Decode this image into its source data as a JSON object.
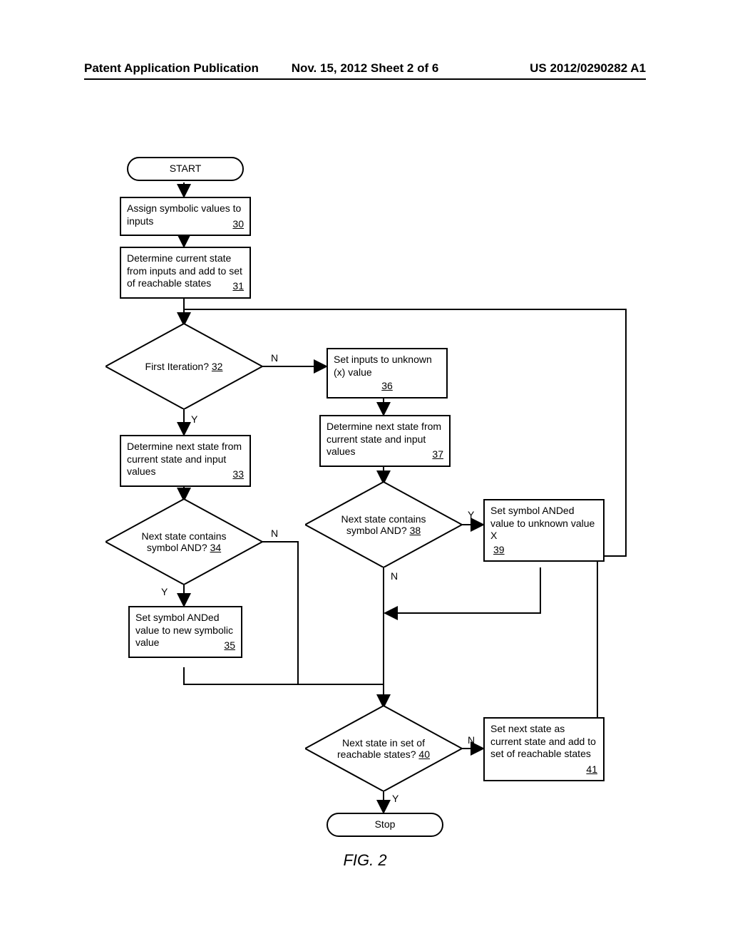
{
  "header": {
    "left": "Patent Application Publication",
    "center": "Nov. 15, 2012  Sheet 2 of 6",
    "right": "US 2012/0290282 A1"
  },
  "start": {
    "label": "START"
  },
  "stop": {
    "label": "Stop"
  },
  "box30": {
    "text": "Assign symbolic values to inputs",
    "ref": "30"
  },
  "box31": {
    "text": "Determine current state from inputs and add to set of reachable states",
    "ref": "31"
  },
  "dec32": {
    "text": "First Iteration?",
    "ref": "32"
  },
  "box33": {
    "text": "Determine next state from current state and input values",
    "ref": "33"
  },
  "dec34": {
    "text": "Next state contains symbol AND?",
    "ref": "34"
  },
  "box35": {
    "text": "Set symbol ANDed value to new symbolic value",
    "ref": "35"
  },
  "box36": {
    "text": "Set inputs to unknown (x) value",
    "ref": "36"
  },
  "box37": {
    "text": "Determine next state from current state and input values",
    "ref": "37"
  },
  "dec38": {
    "text": "Next state contains symbol AND?",
    "ref": "38"
  },
  "box39": {
    "text": "Set symbol ANDed value to unknown value X",
    "ref": "39"
  },
  "dec40": {
    "text": "Next state in set of reachable states?",
    "ref": "40"
  },
  "box41": {
    "text": "Set next state as current state and add to set of reachable states",
    "ref": "41"
  },
  "labels": {
    "Y": "Y",
    "N": "N"
  },
  "fig": "FIG. 2",
  "chart_data": {
    "type": "flowchart",
    "nodes": [
      {
        "id": "start",
        "type": "terminator",
        "label": "START"
      },
      {
        "id": "30",
        "type": "process",
        "label": "Assign symbolic values to inputs"
      },
      {
        "id": "31",
        "type": "process",
        "label": "Determine current state from inputs and add to set of reachable states"
      },
      {
        "id": "32",
        "type": "decision",
        "label": "First Iteration?"
      },
      {
        "id": "33",
        "type": "process",
        "label": "Determine next state from current state and input values"
      },
      {
        "id": "34",
        "type": "decision",
        "label": "Next state contains symbol AND?"
      },
      {
        "id": "35",
        "type": "process",
        "label": "Set symbol ANDed value to new symbolic value"
      },
      {
        "id": "36",
        "type": "process",
        "label": "Set inputs to unknown (x) value"
      },
      {
        "id": "37",
        "type": "process",
        "label": "Determine next state from current state and input values"
      },
      {
        "id": "38",
        "type": "decision",
        "label": "Next state contains symbol AND?"
      },
      {
        "id": "39",
        "type": "process",
        "label": "Set symbol ANDed value to unknown value X"
      },
      {
        "id": "40",
        "type": "decision",
        "label": "Next state in set of reachable states?"
      },
      {
        "id": "41",
        "type": "process",
        "label": "Set next state as current state and add to set of reachable states"
      },
      {
        "id": "stop",
        "type": "terminator",
        "label": "Stop"
      }
    ],
    "edges": [
      {
        "from": "start",
        "to": "30"
      },
      {
        "from": "30",
        "to": "31"
      },
      {
        "from": "31",
        "to": "32"
      },
      {
        "from": "32",
        "to": "33",
        "label": "Y"
      },
      {
        "from": "32",
        "to": "36",
        "label": "N"
      },
      {
        "from": "33",
        "to": "34"
      },
      {
        "from": "34",
        "to": "35",
        "label": "Y"
      },
      {
        "from": "34",
        "to": "40_merge",
        "label": "N"
      },
      {
        "from": "35",
        "to": "40_merge"
      },
      {
        "from": "36",
        "to": "37"
      },
      {
        "from": "37",
        "to": "38"
      },
      {
        "from": "38",
        "to": "39",
        "label": "Y"
      },
      {
        "from": "38",
        "to": "40_merge",
        "label": "N"
      },
      {
        "from": "39",
        "to": "40_merge"
      },
      {
        "from": "40",
        "to": "stop",
        "label": "Y"
      },
      {
        "from": "40",
        "to": "41",
        "label": "N"
      },
      {
        "from": "41",
        "to": "32",
        "note": "loop back"
      }
    ],
    "figure_label": "FIG. 2"
  }
}
